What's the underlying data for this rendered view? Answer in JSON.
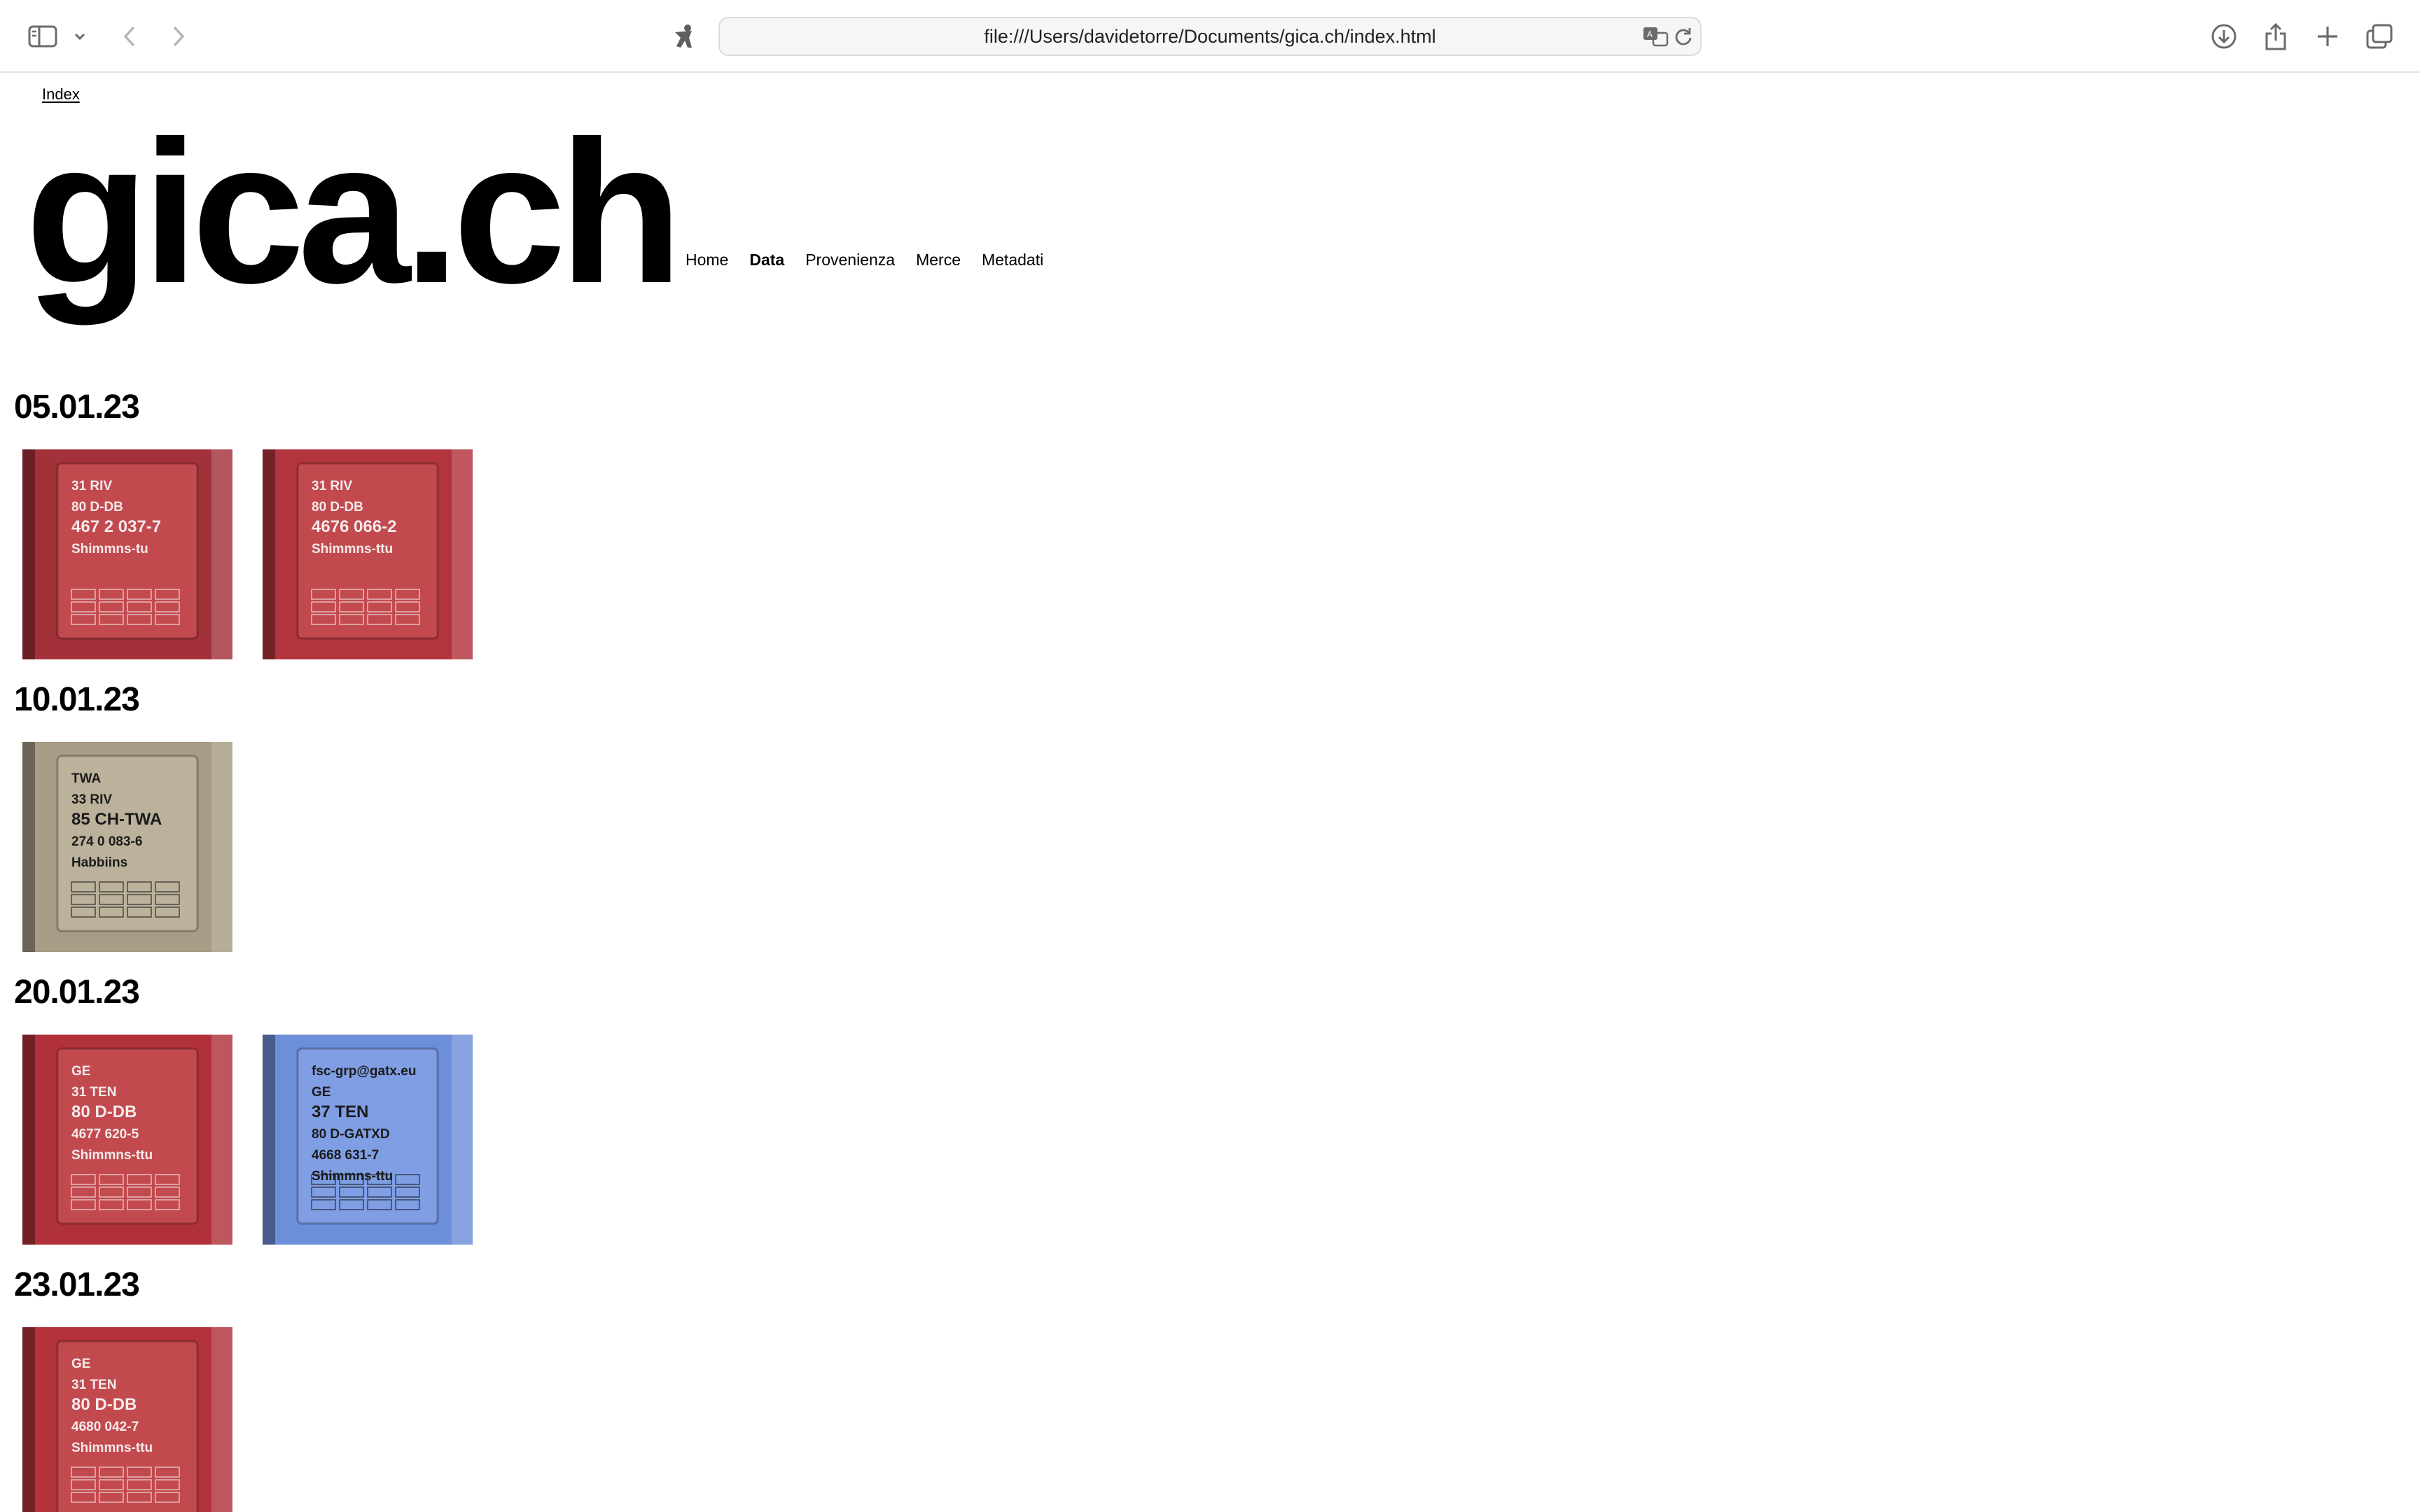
{
  "browser": {
    "url": "file:///Users/davidetorre/Documents/gica.ch/index.html",
    "icons": [
      "sidebar-icon",
      "chevron-down-icon",
      "back-icon",
      "forward-icon",
      "privacy-icon",
      "translate-icon",
      "reload-icon",
      "download-icon",
      "share-icon",
      "new-tab-icon",
      "tab-overview-icon"
    ]
  },
  "page": {
    "index_link": "Index",
    "title": "gica.ch",
    "nav": [
      {
        "label": "Home",
        "active": false
      },
      {
        "label": "Data",
        "active": true
      },
      {
        "label": "Provenienza",
        "active": false
      },
      {
        "label": "Merce",
        "active": false
      },
      {
        "label": "Metadati",
        "active": false
      }
    ],
    "groups": [
      {
        "date": "05.01.23",
        "photos": [
          {
            "lines": [
              "31 RIV",
              "80 D-DB",
              "467 2 037-7",
              "Shimmns-tu"
            ],
            "color": "#a3313a"
          },
          {
            "lines": [
              "31 RIV",
              "80 D-DB",
              "4676 066-2",
              "Shimmns-ttu"
            ],
            "color": "#b2343d"
          }
        ]
      },
      {
        "date": "10.01.23",
        "photos": [
          {
            "lines": [
              "TWA",
              "33 RIV",
              "85 CH-TWA",
              "274 0 083-6",
              "Habbiins"
            ],
            "color": "#a79c86"
          }
        ]
      },
      {
        "date": "20.01.23",
        "photos": [
          {
            "lines": [
              "GE",
              "31 TEN",
              "80 D-DB",
              "4677 620-5",
              "Shimmns-ttu"
            ],
            "color": "#b0313a"
          },
          {
            "lines": [
              "fsc-grp@gatx.eu",
              "GE",
              "37 TEN",
              "80 D-GATXD",
              "4668 631-7",
              "Shimmns-ttu"
            ],
            "color": "#6d8ed8"
          }
        ]
      },
      {
        "date": "23.01.23",
        "photos": [
          {
            "lines": [
              "GE",
              "31 TEN",
              "80 D-DB",
              "4680 042-7",
              "Shimmns-ttu"
            ],
            "color": "#b3323b"
          }
        ]
      }
    ]
  }
}
